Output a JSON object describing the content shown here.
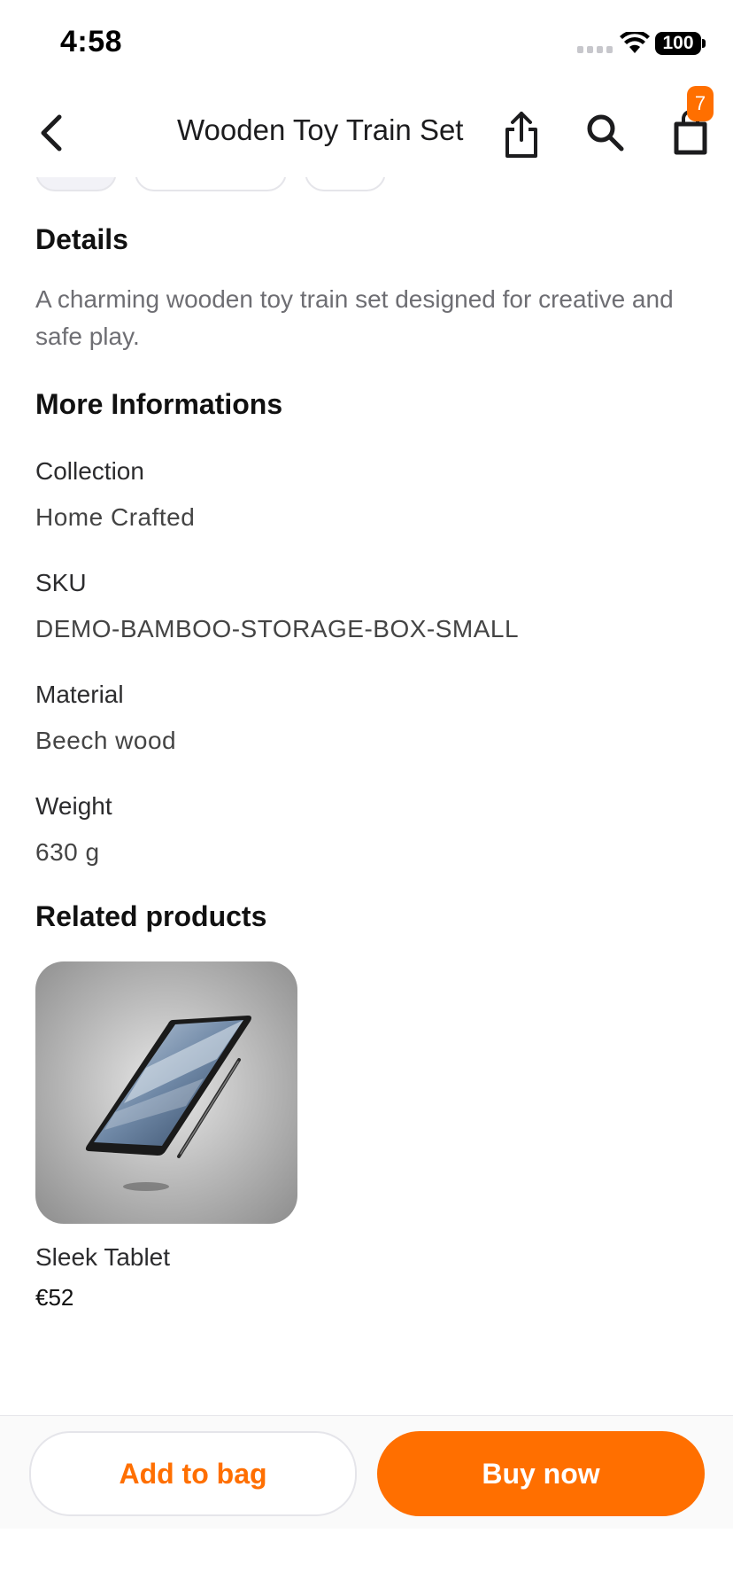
{
  "status": {
    "time": "4:58",
    "battery": "100"
  },
  "nav": {
    "title": "Wooden Toy Train Set",
    "bag_count": "7"
  },
  "details": {
    "title": "Details",
    "description": "A charming wooden toy train set designed for creative and safe play."
  },
  "more_info": {
    "title": "More Informations",
    "items": [
      {
        "label": "Collection",
        "value": "Home Crafted"
      },
      {
        "label": "SKU",
        "value": "DEMO-BAMBOO-STORAGE-BOX-SMALL"
      },
      {
        "label": "Material",
        "value": "Beech wood"
      },
      {
        "label": "Weight",
        "value": "630 g"
      }
    ]
  },
  "related": {
    "title": "Related products",
    "products": [
      {
        "name": "Sleek Tablet",
        "price": "€52"
      }
    ]
  },
  "actions": {
    "add_to_bag": "Add to bag",
    "buy_now": "Buy now"
  },
  "colors": {
    "accent": "#ff6f00"
  }
}
